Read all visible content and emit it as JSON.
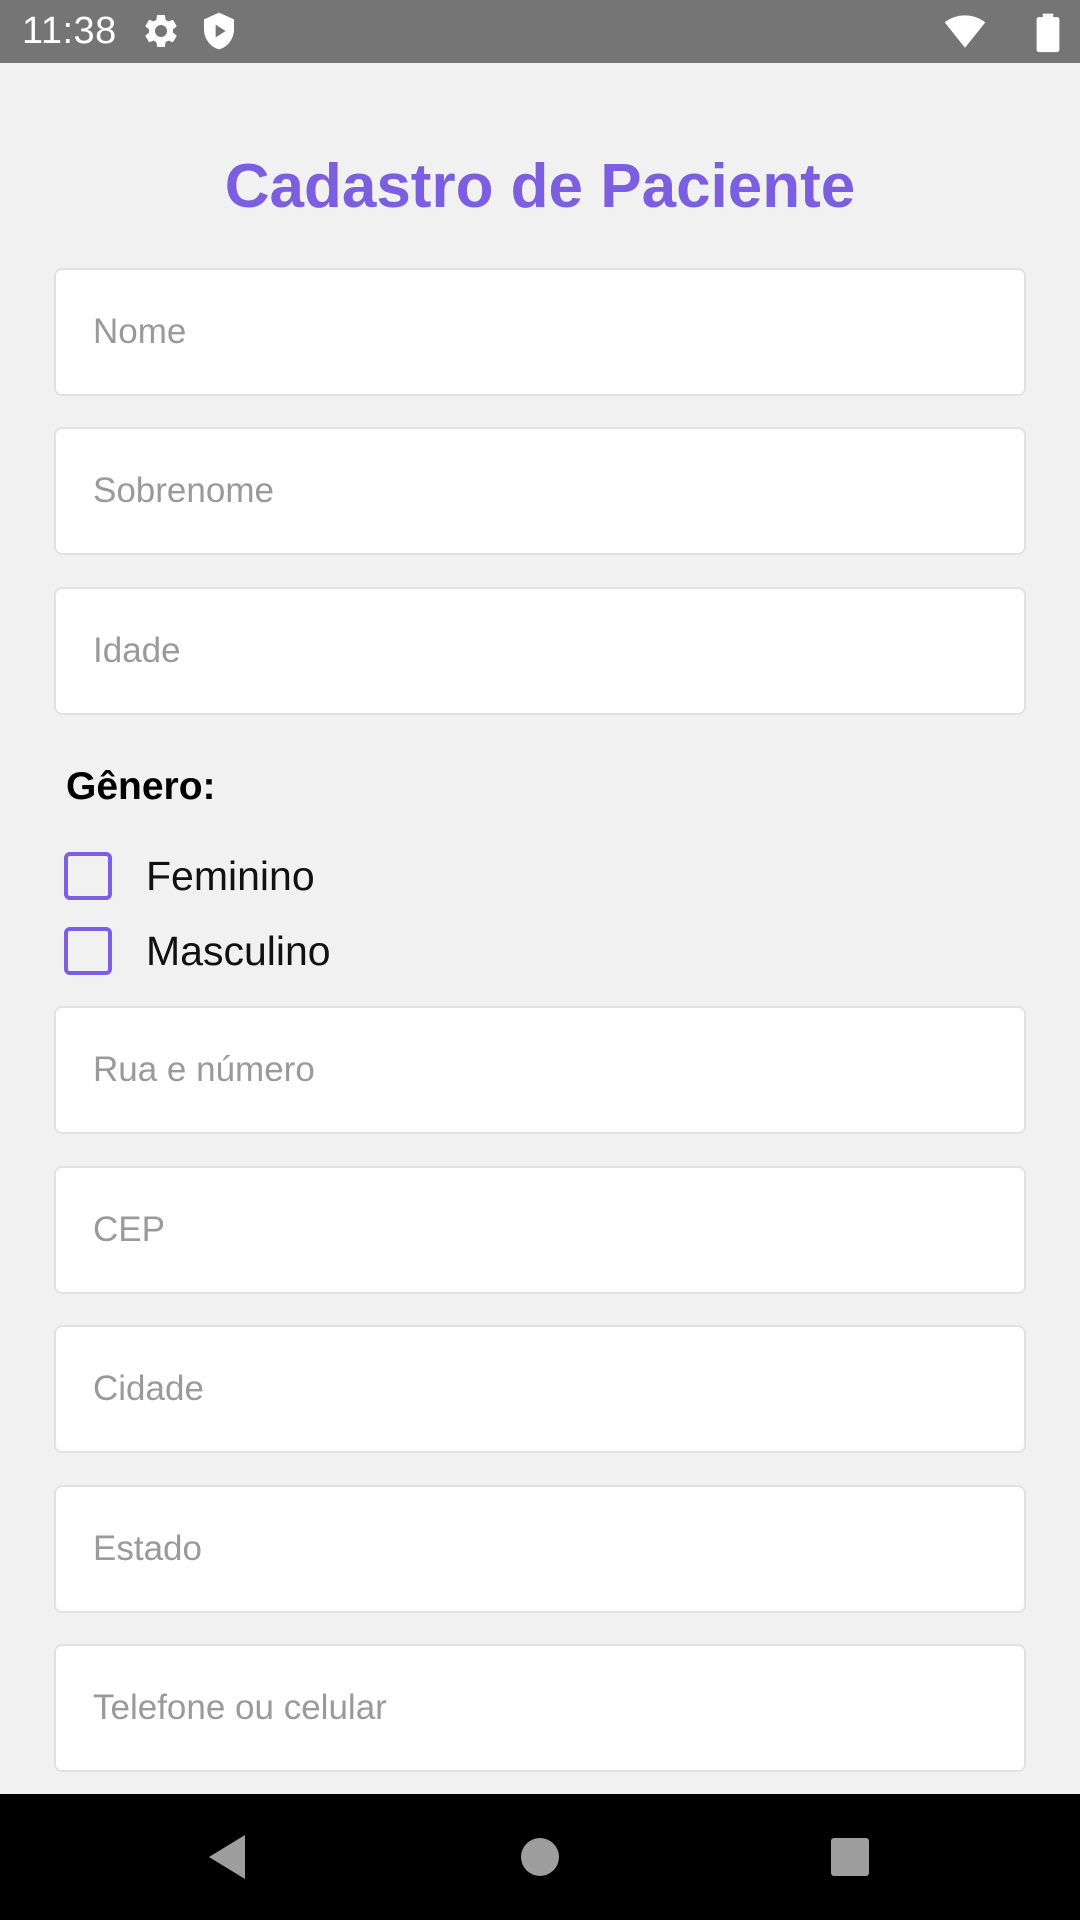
{
  "status_bar": {
    "time": "11:38",
    "icons": [
      "gear-icon",
      "shield-icon",
      "wifi-icon",
      "battery-icon"
    ]
  },
  "form": {
    "title": "Cadastro de Paciente",
    "fields": {
      "nome": {
        "placeholder": "Nome",
        "value": ""
      },
      "sobrenome": {
        "placeholder": "Sobrenome",
        "value": ""
      },
      "idade": {
        "placeholder": "Idade",
        "value": ""
      },
      "rua": {
        "placeholder": "Rua e número",
        "value": ""
      },
      "cep": {
        "placeholder": "CEP",
        "value": ""
      },
      "cidade": {
        "placeholder": "Cidade",
        "value": ""
      },
      "estado": {
        "placeholder": "Estado",
        "value": ""
      },
      "telefone": {
        "placeholder": "Telefone ou celular",
        "value": ""
      }
    },
    "gender": {
      "label": "Gênero:",
      "options": [
        {
          "label": "Feminino",
          "checked": false
        },
        {
          "label": "Masculino",
          "checked": false
        }
      ]
    }
  },
  "nav_bar": {
    "buttons": [
      "back-icon",
      "home-icon",
      "recents-icon"
    ]
  },
  "colors": {
    "accent": "#7b5fe0",
    "status_bar": "#757575",
    "background": "#f1f1f1",
    "placeholder": "#9a9a9a",
    "nav_bar": "#000000"
  }
}
